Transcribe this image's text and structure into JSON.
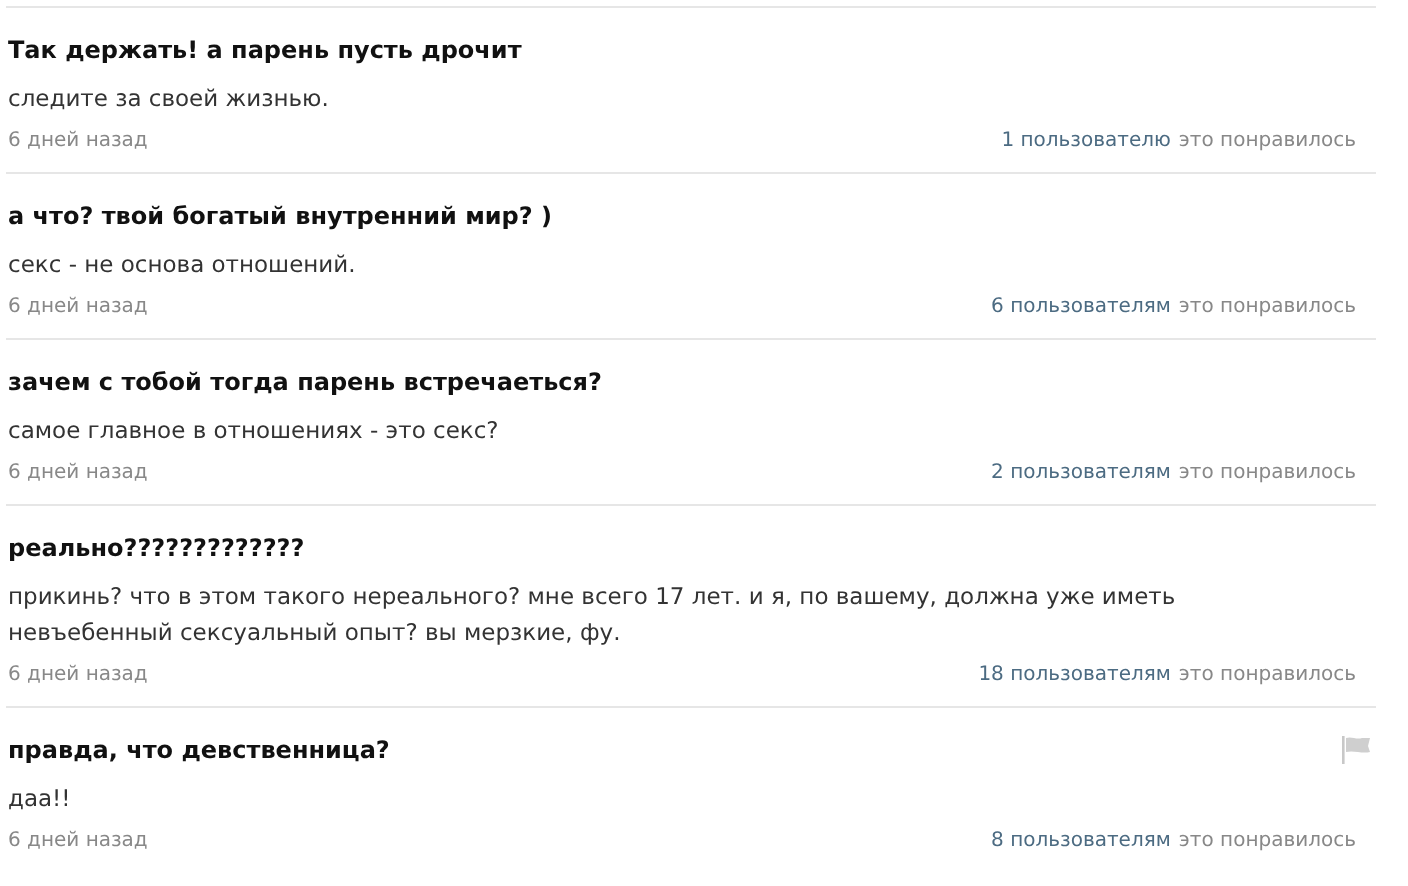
{
  "answers": [
    {
      "question": "Так держать! а парень пусть дрочит",
      "answer": "следите за своей жизнью.",
      "time": "6 дней назад",
      "likes_count": "1 пользователю",
      "likes_text": "это понравилось",
      "hovered": false
    },
    {
      "question": "а что? твой богатый внутренний мир? )",
      "answer": "секс - не основа отношений.",
      "time": "6 дней назад",
      "likes_count": "6 пользователям",
      "likes_text": "это понравилось",
      "hovered": false
    },
    {
      "question": "зачем с тобой тогда парень встречаеться?",
      "answer": "самое главное в отношениях - это секс?",
      "time": "6 дней назад",
      "likes_count": "2 пользователям",
      "likes_text": "это понравилось",
      "hovered": false
    },
    {
      "question": "реально?????????????",
      "answer": "прикинь? что в этом такого нереального? мне всего 17 лет. и я, по вашему, должна уже иметь невъебенный сексуальный опыт? вы мерзкие, фу.",
      "time": "6 дней назад",
      "likes_count": "18 пользователям",
      "likes_text": "это понравилось",
      "hovered": false
    },
    {
      "question": "правда, что девственница?",
      "answer": "даа!!",
      "time": "6 дней назад",
      "likes_count": "8 пользователям",
      "likes_text": "это понравилось",
      "hovered": true
    }
  ]
}
